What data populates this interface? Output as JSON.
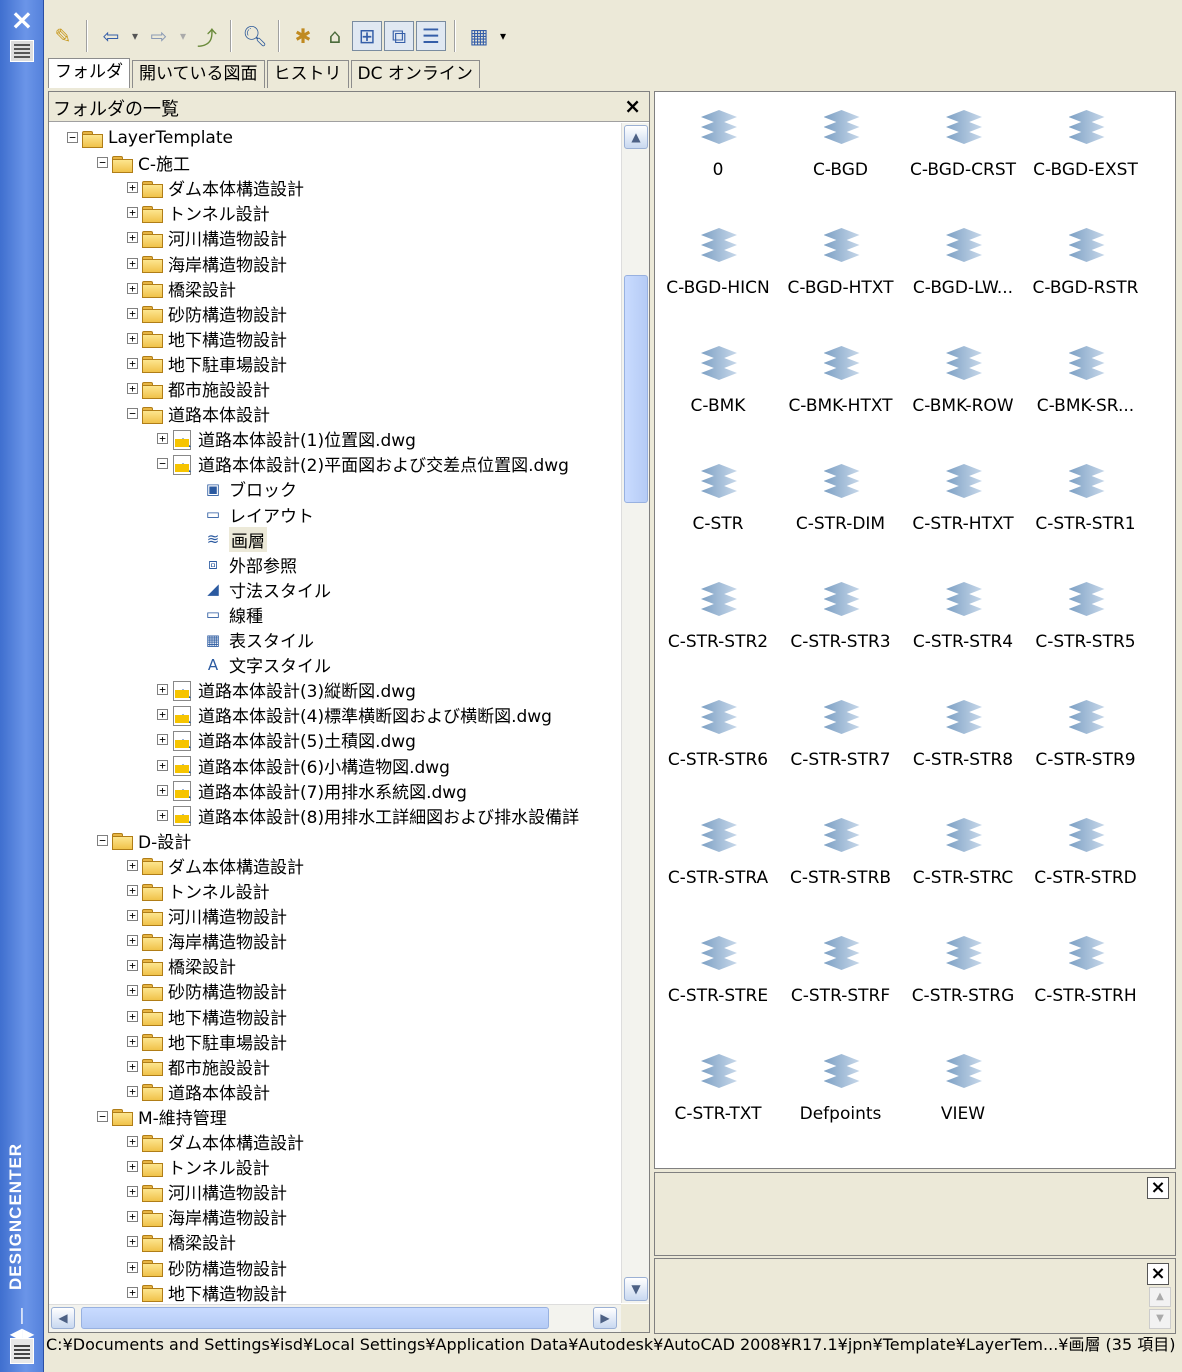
{
  "window": {
    "vertical_title": "DESIGNCENTER"
  },
  "tabs": [
    {
      "label": "フォルダ"
    },
    {
      "label": "開いている図面"
    },
    {
      "label": "ヒストリ"
    },
    {
      "label": "DC オンライン"
    }
  ],
  "tree": {
    "header_title": "フォルダの一覧",
    "close_label": "×",
    "nodes": [
      {
        "label": "LayerTemplate",
        "depth": 0,
        "icon": "folder",
        "state": "open"
      },
      {
        "label": "C-施工",
        "depth": 1,
        "icon": "folder",
        "state": "open"
      },
      {
        "label": "ダム本体構造設計",
        "depth": 2,
        "icon": "folder",
        "state": "closed"
      },
      {
        "label": "トンネル設計",
        "depth": 2,
        "icon": "folder",
        "state": "closed"
      },
      {
        "label": "河川構造物設計",
        "depth": 2,
        "icon": "folder",
        "state": "closed"
      },
      {
        "label": "海岸構造物設計",
        "depth": 2,
        "icon": "folder",
        "state": "closed"
      },
      {
        "label": "橋梁設計",
        "depth": 2,
        "icon": "folder",
        "state": "closed"
      },
      {
        "label": "砂防構造物設計",
        "depth": 2,
        "icon": "folder",
        "state": "closed"
      },
      {
        "label": "地下構造物設計",
        "depth": 2,
        "icon": "folder",
        "state": "closed"
      },
      {
        "label": "地下駐車場設計",
        "depth": 2,
        "icon": "folder",
        "state": "closed"
      },
      {
        "label": "都市施設設計",
        "depth": 2,
        "icon": "folder",
        "state": "closed"
      },
      {
        "label": "道路本体設計",
        "depth": 2,
        "icon": "folder",
        "state": "open"
      },
      {
        "label": "道路本体設計(1)位置図.dwg",
        "depth": 3,
        "icon": "dwg",
        "state": "closed"
      },
      {
        "label": "道路本体設計(2)平面図および交差点位置図.dwg",
        "depth": 3,
        "icon": "dwg",
        "state": "open"
      },
      {
        "label": "ブロック",
        "depth": 4,
        "icon": "block",
        "state": "leaf"
      },
      {
        "label": "レイアウト",
        "depth": 4,
        "icon": "layout",
        "state": "leaf"
      },
      {
        "label": "画層",
        "depth": 4,
        "icon": "layer",
        "state": "leaf",
        "selected": true
      },
      {
        "label": "外部参照",
        "depth": 4,
        "icon": "xref",
        "state": "leaf"
      },
      {
        "label": "寸法スタイル",
        "depth": 4,
        "icon": "dimstyle",
        "state": "leaf"
      },
      {
        "label": "線種",
        "depth": 4,
        "icon": "linetype",
        "state": "leaf"
      },
      {
        "label": "表スタイル",
        "depth": 4,
        "icon": "tablestyle",
        "state": "leaf"
      },
      {
        "label": "文字スタイル",
        "depth": 4,
        "icon": "textstyle",
        "state": "leaf"
      },
      {
        "label": "道路本体設計(3)縦断図.dwg",
        "depth": 3,
        "icon": "dwg",
        "state": "closed"
      },
      {
        "label": "道路本体設計(4)標準横断図および横断図.dwg",
        "depth": 3,
        "icon": "dwg",
        "state": "closed"
      },
      {
        "label": "道路本体設計(5)土積図.dwg",
        "depth": 3,
        "icon": "dwg",
        "state": "closed"
      },
      {
        "label": "道路本体設計(6)小構造物図.dwg",
        "depth": 3,
        "icon": "dwg",
        "state": "closed"
      },
      {
        "label": "道路本体設計(7)用排水系統図.dwg",
        "depth": 3,
        "icon": "dwg",
        "state": "closed"
      },
      {
        "label": "道路本体設計(8)用排水工詳細図および排水設備詳",
        "depth": 3,
        "icon": "dwg",
        "state": "closed"
      },
      {
        "label": "D-設計",
        "depth": 1,
        "icon": "folder",
        "state": "open"
      },
      {
        "label": "ダム本体構造設計",
        "depth": 2,
        "icon": "folder",
        "state": "closed"
      },
      {
        "label": "トンネル設計",
        "depth": 2,
        "icon": "folder",
        "state": "closed"
      },
      {
        "label": "河川構造物設計",
        "depth": 2,
        "icon": "folder",
        "state": "closed"
      },
      {
        "label": "海岸構造物設計",
        "depth": 2,
        "icon": "folder",
        "state": "closed"
      },
      {
        "label": "橋梁設計",
        "depth": 2,
        "icon": "folder",
        "state": "closed"
      },
      {
        "label": "砂防構造物設計",
        "depth": 2,
        "icon": "folder",
        "state": "closed"
      },
      {
        "label": "地下構造物設計",
        "depth": 2,
        "icon": "folder",
        "state": "closed"
      },
      {
        "label": "地下駐車場設計",
        "depth": 2,
        "icon": "folder",
        "state": "closed"
      },
      {
        "label": "都市施設設計",
        "depth": 2,
        "icon": "folder",
        "state": "closed"
      },
      {
        "label": "道路本体設計",
        "depth": 2,
        "icon": "folder",
        "state": "closed"
      },
      {
        "label": "M-維持管理",
        "depth": 1,
        "icon": "folder",
        "state": "open"
      },
      {
        "label": "ダム本体構造設計",
        "depth": 2,
        "icon": "folder",
        "state": "closed"
      },
      {
        "label": "トンネル設計",
        "depth": 2,
        "icon": "folder",
        "state": "closed"
      },
      {
        "label": "河川構造物設計",
        "depth": 2,
        "icon": "folder",
        "state": "closed"
      },
      {
        "label": "海岸構造物設計",
        "depth": 2,
        "icon": "folder",
        "state": "closed"
      },
      {
        "label": "橋梁設計",
        "depth": 2,
        "icon": "folder",
        "state": "closed"
      },
      {
        "label": "砂防構造物設計",
        "depth": 2,
        "icon": "folder",
        "state": "closed"
      },
      {
        "label": "地下構造物設計",
        "depth": 2,
        "icon": "folder",
        "state": "closed"
      }
    ]
  },
  "content": {
    "items": [
      "0",
      "C-BGD",
      "C-BGD-CRST",
      "C-BGD-EXST",
      "C-BGD-HICN",
      "C-BGD-HTXT",
      "C-BGD-LW...",
      "C-BGD-RSTR",
      "C-BMK",
      "C-BMK-HTXT",
      "C-BMK-ROW",
      "C-BMK-SR...",
      "C-STR",
      "C-STR-DIM",
      "C-STR-HTXT",
      "C-STR-STR1",
      "C-STR-STR2",
      "C-STR-STR3",
      "C-STR-STR4",
      "C-STR-STR5",
      "C-STR-STR6",
      "C-STR-STR7",
      "C-STR-STR8",
      "C-STR-STR9",
      "C-STR-STRA",
      "C-STR-STRB",
      "C-STR-STRC",
      "C-STR-STRD",
      "C-STR-STRE",
      "C-STR-STRF",
      "C-STR-STRG",
      "C-STR-STRH",
      "C-STR-TXT",
      "Defpoints",
      "VIEW"
    ]
  },
  "panes": {
    "preview_close": "×",
    "description_close": "×"
  },
  "statusbar": {
    "text": "C:¥Documents and Settings¥isd¥Local Settings¥Application Data¥Autodesk¥AutoCAD 2008¥R17.1¥jpn¥Template¥LayerTem...¥画層 (35 項目)"
  }
}
